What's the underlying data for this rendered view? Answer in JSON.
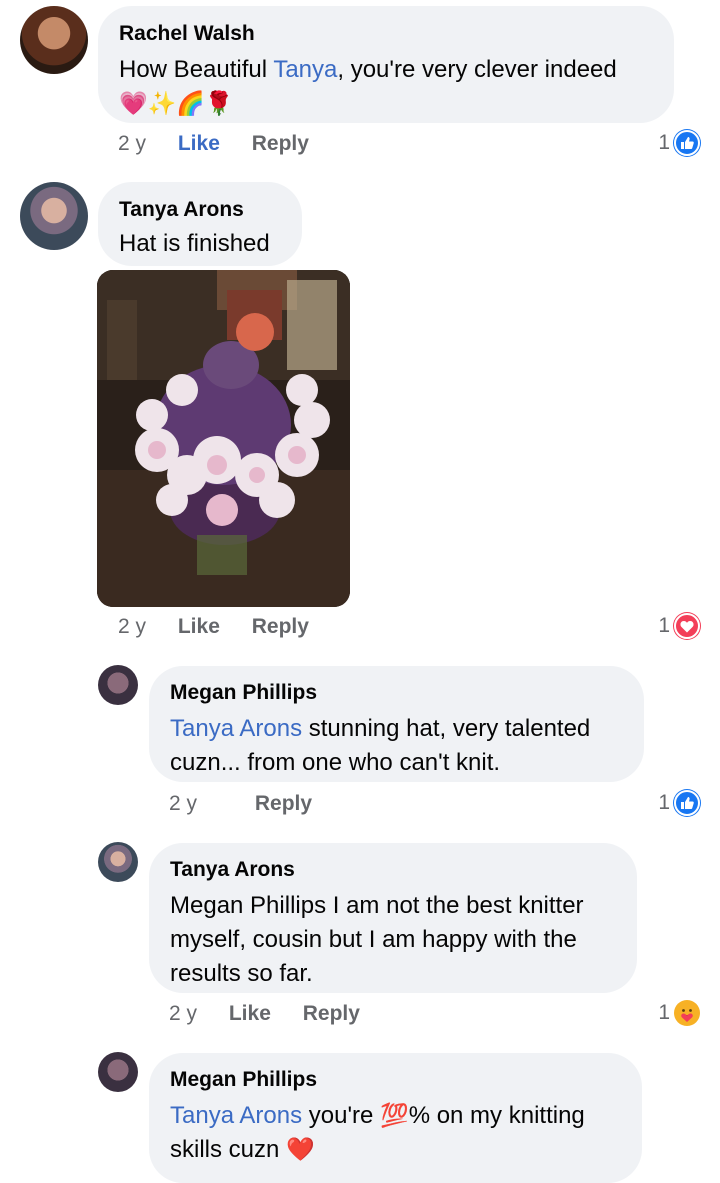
{
  "comments": [
    {
      "author": "Rachel Walsh",
      "text_before": "How Beautiful ",
      "mention": "Tanya",
      "text_after": ", you're very clever indeed",
      "emojis": "💗✨🌈🌹",
      "time": "2 y",
      "like": "Like",
      "reply": "Reply",
      "reaction_count": "1",
      "reaction_type": "like",
      "avatar_icon": "profile-photo-icon"
    },
    {
      "author": "Tanya Arons",
      "text": "Hat is finished",
      "time": "2 y",
      "like": "Like",
      "reply": "Reply",
      "reaction_count": "1",
      "reaction_type": "love",
      "avatar_icon": "profile-photo-icon",
      "photo_icon": "knitted-hat-photo"
    }
  ],
  "replies": [
    {
      "author": "Megan Phillips",
      "mention": "Tanya Arons",
      "text_after": " stunning hat, very talented cuzn... from one who can't knit.",
      "time": "2 y",
      "reply": "Reply",
      "reaction_count": "1",
      "reaction_type": "like"
    },
    {
      "author": "Tanya Arons",
      "text": "Megan Phillips I am not the best knitter myself, cousin but I am happy with the results so far.",
      "time": "2 y",
      "like": "Like",
      "reply": "Reply",
      "reaction_count": "1",
      "reaction_type": "care"
    },
    {
      "author": "Megan Phillips",
      "mention": "Tanya Arons",
      "text_mid": " you're ",
      "emoji_100": "💯",
      "text_after": "% on my knitting skills cuzn ",
      "emoji_heart": "❤️"
    }
  ],
  "colors": {
    "bubble": "#f0f2f5",
    "link_blue": "#3b6bc4",
    "meta_gray": "#65676b",
    "like_blue": "#1877f2",
    "love_red": "#f33e58"
  }
}
